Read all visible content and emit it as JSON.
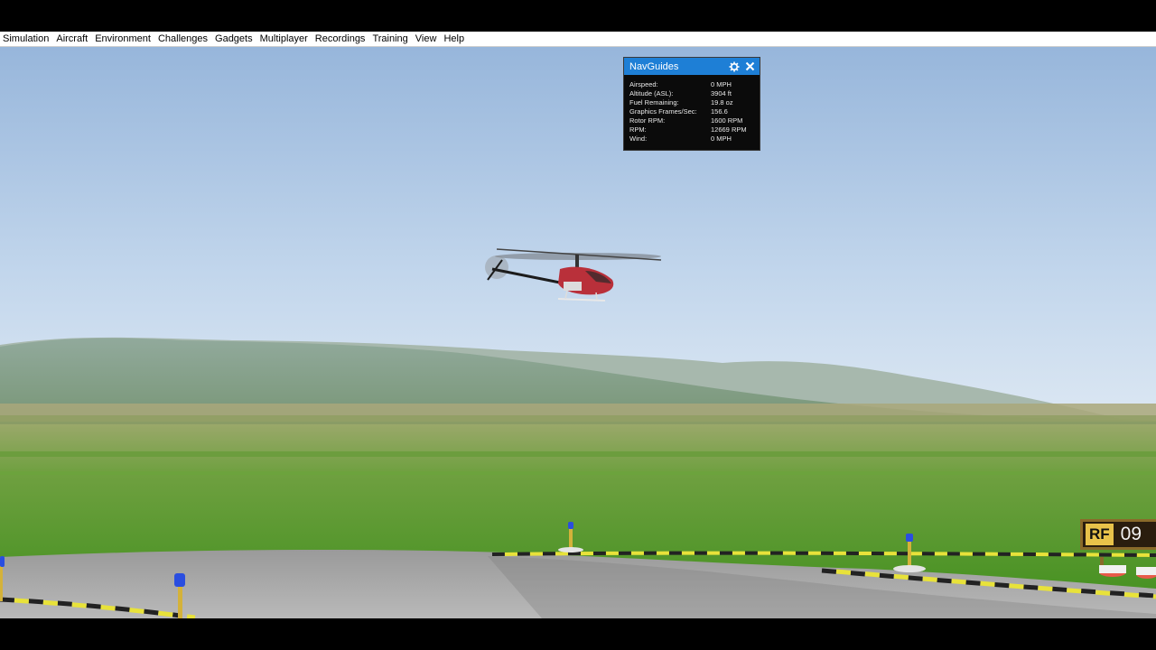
{
  "menu": {
    "items": [
      "Simulation",
      "Aircraft",
      "Environment",
      "Challenges",
      "Gadgets",
      "Multiplayer",
      "Recordings",
      "Training",
      "View",
      "Help"
    ]
  },
  "navguides": {
    "title": "NavGuides",
    "icons": [
      "gear-icon",
      "close-icon"
    ],
    "rows": [
      {
        "label": "Airspeed:",
        "value": "0 MPH"
      },
      {
        "label": "Altitude (ASL):",
        "value": "3904 ft"
      },
      {
        "label": "Fuel Remaining:",
        "value": "19.8 oz"
      },
      {
        "label": "Graphics Frames/Sec:",
        "value": "156.6"
      },
      {
        "label": "Rotor RPM:",
        "value": "1600 RPM"
      },
      {
        "label": "RPM:",
        "value": "12669 RPM"
      },
      {
        "label": "Wind:",
        "value": "0 MPH"
      }
    ]
  },
  "runway_sign": {
    "left": "RF",
    "right": "09"
  },
  "colors": {
    "titlebar": "#1e7fd6",
    "sky_top": "#97b6db",
    "grass": "#4f9a2a"
  }
}
